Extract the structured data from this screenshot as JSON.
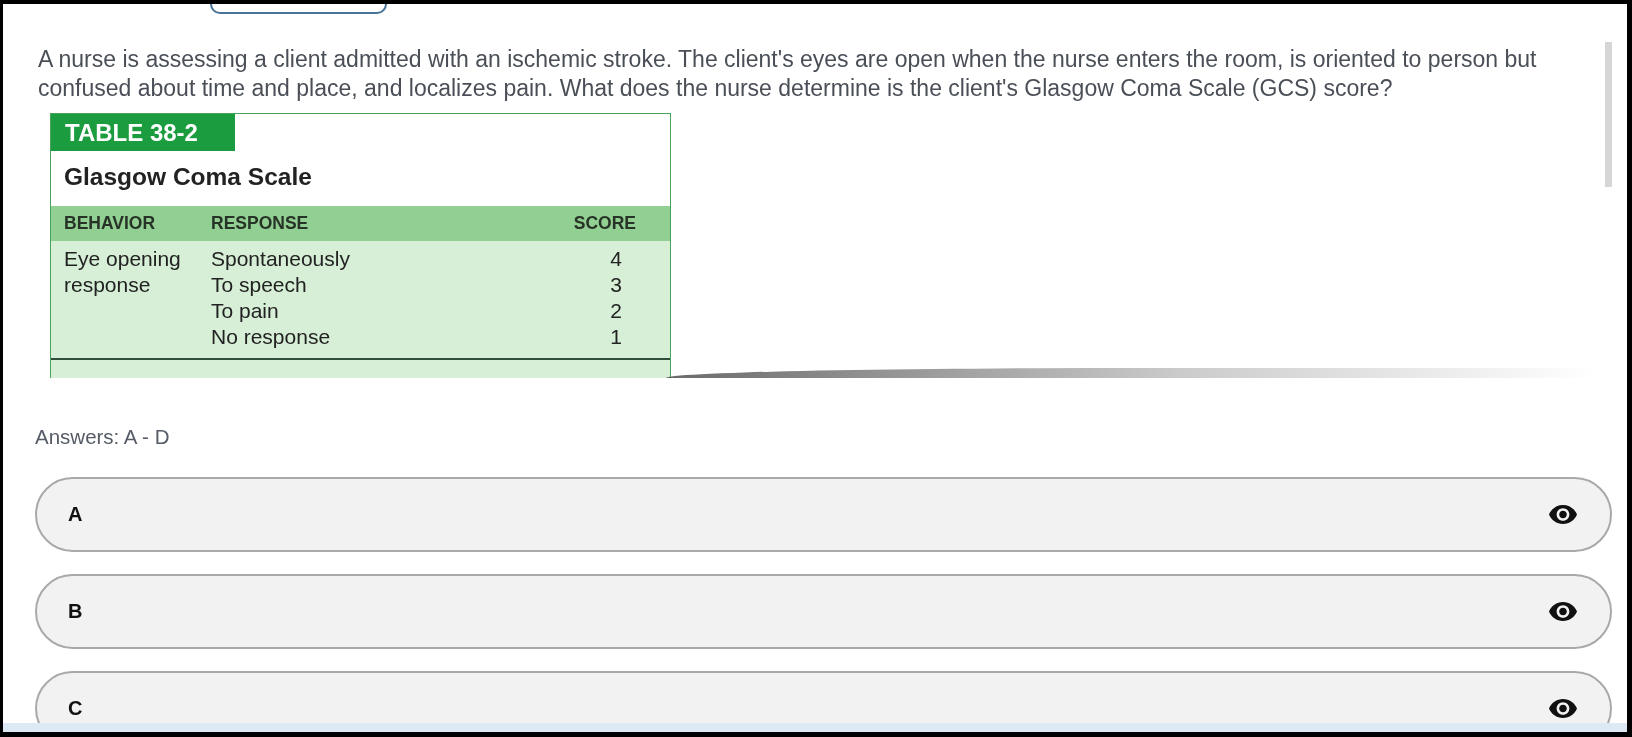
{
  "question": {
    "text": "A nurse is assessing a client admitted with an ischemic stroke. The client's eyes are open when the nurse enters the room, is oriented to person but confused about time and place, and localizes pain. What does the nurse determine is the client's Glasgow Coma Scale (GCS) score?",
    "table": {
      "label": "TABLE 38-2",
      "title": "Glasgow Coma Scale",
      "columns": [
        "BEHAVIOR",
        "RESPONSE",
        "SCORE"
      ],
      "rows": [
        {
          "behavior": "Eye opening response",
          "responses": [
            {
              "response": "Spontaneously",
              "score": "4"
            },
            {
              "response": "To speech",
              "score": "3"
            },
            {
              "response": "To pain",
              "score": "2"
            },
            {
              "response": "No response",
              "score": "1"
            }
          ]
        }
      ]
    }
  },
  "answers": {
    "label": "Answers: A - D",
    "options": [
      {
        "label": "A"
      },
      {
        "label": "B"
      },
      {
        "label": "C"
      }
    ]
  }
}
